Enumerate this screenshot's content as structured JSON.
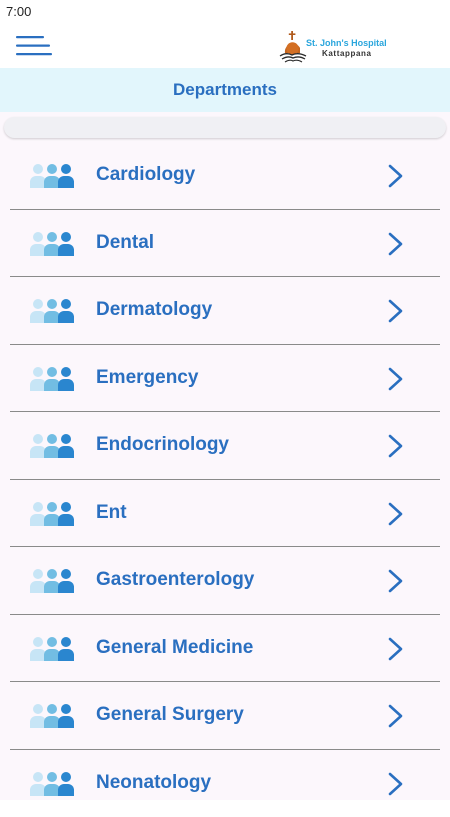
{
  "status_bar": {
    "time": "7:00"
  },
  "app_bar": {
    "menu_icon": "hamburger-menu-icon",
    "logo": {
      "name": "St. John's Hospital",
      "place": "Kattappana"
    }
  },
  "page": {
    "title": "Departments"
  },
  "colors": {
    "accent": "#2a6fc0",
    "header_background": "#e2f6fc",
    "list_background": "#fcf7fc",
    "icon_light": "#c7e5f6",
    "icon_mid": "#72bde3",
    "icon_dark": "#2a86cf"
  },
  "departments": [
    {
      "label": "Cardiology",
      "icon": "people-group-icon",
      "action_icon": "chevron-right-icon"
    },
    {
      "label": "Dental",
      "icon": "people-group-icon",
      "action_icon": "chevron-right-icon"
    },
    {
      "label": "Dermatology",
      "icon": "people-group-icon",
      "action_icon": "chevron-right-icon"
    },
    {
      "label": "Emergency",
      "icon": "people-group-icon",
      "action_icon": "chevron-right-icon"
    },
    {
      "label": "Endocrinology",
      "icon": "people-group-icon",
      "action_icon": "chevron-right-icon"
    },
    {
      "label": "Ent",
      "icon": "people-group-icon",
      "action_icon": "chevron-right-icon"
    },
    {
      "label": "Gastroenterology",
      "icon": "people-group-icon",
      "action_icon": "chevron-right-icon"
    },
    {
      "label": "General Medicine",
      "icon": "people-group-icon",
      "action_icon": "chevron-right-icon"
    },
    {
      "label": "General Surgery",
      "icon": "people-group-icon",
      "action_icon": "chevron-right-icon"
    },
    {
      "label": "Neonatology",
      "icon": "people-group-icon",
      "action_icon": "chevron-right-icon"
    }
  ]
}
